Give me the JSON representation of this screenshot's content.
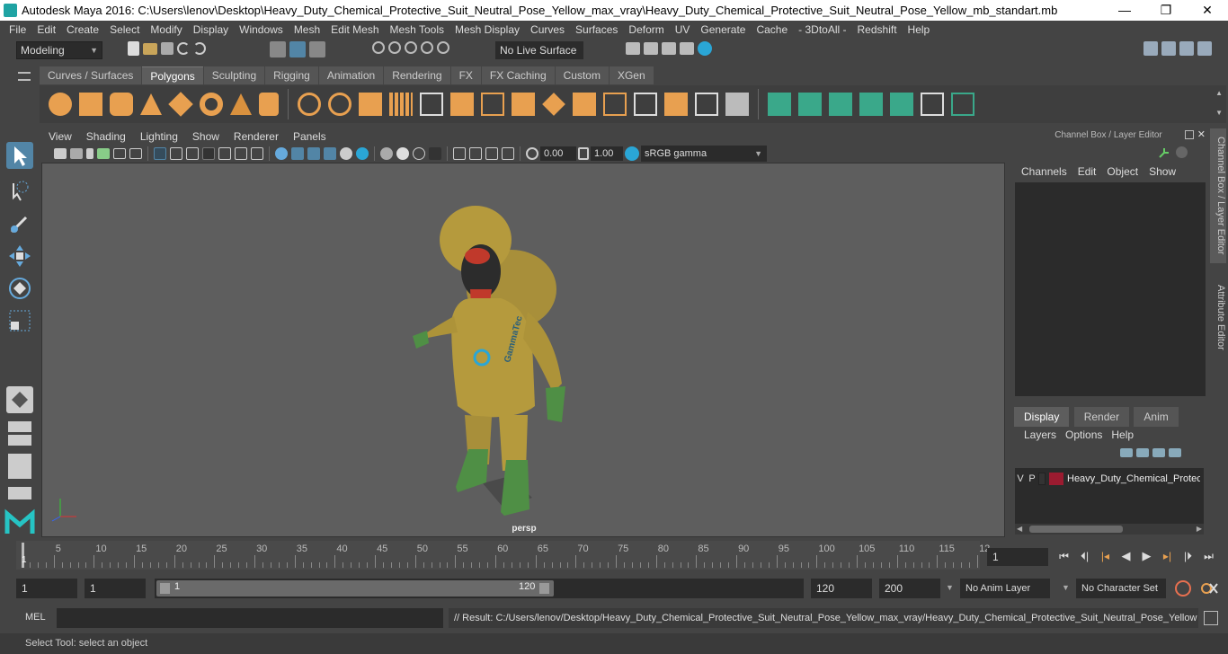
{
  "window": {
    "title": "Autodesk Maya 2016: C:\\Users\\lenov\\Desktop\\Heavy_Duty_Chemical_Protective_Suit_Neutral_Pose_Yellow_max_vray\\Heavy_Duty_Chemical_Protective_Suit_Neutral_Pose_Yellow_mb_standart.mb",
    "minimize": "—",
    "restore": "❐",
    "close": "✕"
  },
  "menubar": [
    "File",
    "Edit",
    "Create",
    "Select",
    "Modify",
    "Display",
    "Windows",
    "Mesh",
    "Edit Mesh",
    "Mesh Tools",
    "Mesh Display",
    "Curves",
    "Surfaces",
    "Deform",
    "UV",
    "Generate",
    "Cache",
    "- 3DtoAll -",
    "Redshift",
    "Help"
  ],
  "statusline": {
    "mode": "Modeling",
    "live_surface": "No Live Surface"
  },
  "shelf_tabs": [
    {
      "label": "Curves / Surfaces",
      "active": false
    },
    {
      "label": "Polygons",
      "active": true
    },
    {
      "label": "Sculpting",
      "active": false
    },
    {
      "label": "Rigging",
      "active": false
    },
    {
      "label": "Animation",
      "active": false
    },
    {
      "label": "Rendering",
      "active": false
    },
    {
      "label": "FX",
      "active": false
    },
    {
      "label": "FX Caching",
      "active": false
    },
    {
      "label": "Custom",
      "active": false
    },
    {
      "label": "XGen",
      "active": false
    }
  ],
  "viewport": {
    "menu": [
      "View",
      "Shading",
      "Lighting",
      "Show",
      "Renderer",
      "Panels"
    ],
    "exposure": "0.00",
    "gamma": "1.00",
    "color_space": "sRGB gamma",
    "camera": "persp",
    "suit_logo": "GammaTec"
  },
  "channelbox": {
    "title": "Channel Box / Layer Editor",
    "menu": [
      "Channels",
      "Edit",
      "Object",
      "Show"
    ],
    "display_tabs": [
      {
        "label": "Display",
        "active": true
      },
      {
        "label": "Render",
        "active": false
      },
      {
        "label": "Anim",
        "active": false
      }
    ],
    "layer_menu": [
      "Layers",
      "Options",
      "Help"
    ],
    "layer": {
      "v": "V",
      "p": "P",
      "name": "Heavy_Duty_Chemical_Protec",
      "color": "#9b1b30"
    }
  },
  "side_tabs": [
    "Channel Box / Layer Editor",
    "Attribute Editor"
  ],
  "timeline": {
    "labels": [
      "5",
      "10",
      "15",
      "20",
      "25",
      "30",
      "35",
      "40",
      "45",
      "50",
      "55",
      "60",
      "65",
      "70",
      "75",
      "80",
      "85",
      "90",
      "95",
      "100",
      "105",
      "110",
      "115",
      "12"
    ],
    "current_marker": "1",
    "current_frame": "1"
  },
  "range": {
    "start": "1",
    "playback_start": "1",
    "slider_start": "1",
    "slider_end": "120",
    "playback_end": "120",
    "end": "200",
    "anim_layer": "No Anim Layer",
    "character_set": "No Character Set"
  },
  "command": {
    "mel": "MEL",
    "result": "// Result: C:/Users/lenov/Desktop/Heavy_Duty_Chemical_Protective_Suit_Neutral_Pose_Yellow_max_vray/Heavy_Duty_Chemical_Protective_Suit_Neutral_Pose_Yellow"
  },
  "helpline": "Select Tool: select an object",
  "colors": {
    "accent": "#5285a6",
    "shelf_orange": "#e8a050",
    "shelf_teal": "#3aa88a",
    "suit": "#b59a3d",
    "boots": "#4f8f45"
  }
}
